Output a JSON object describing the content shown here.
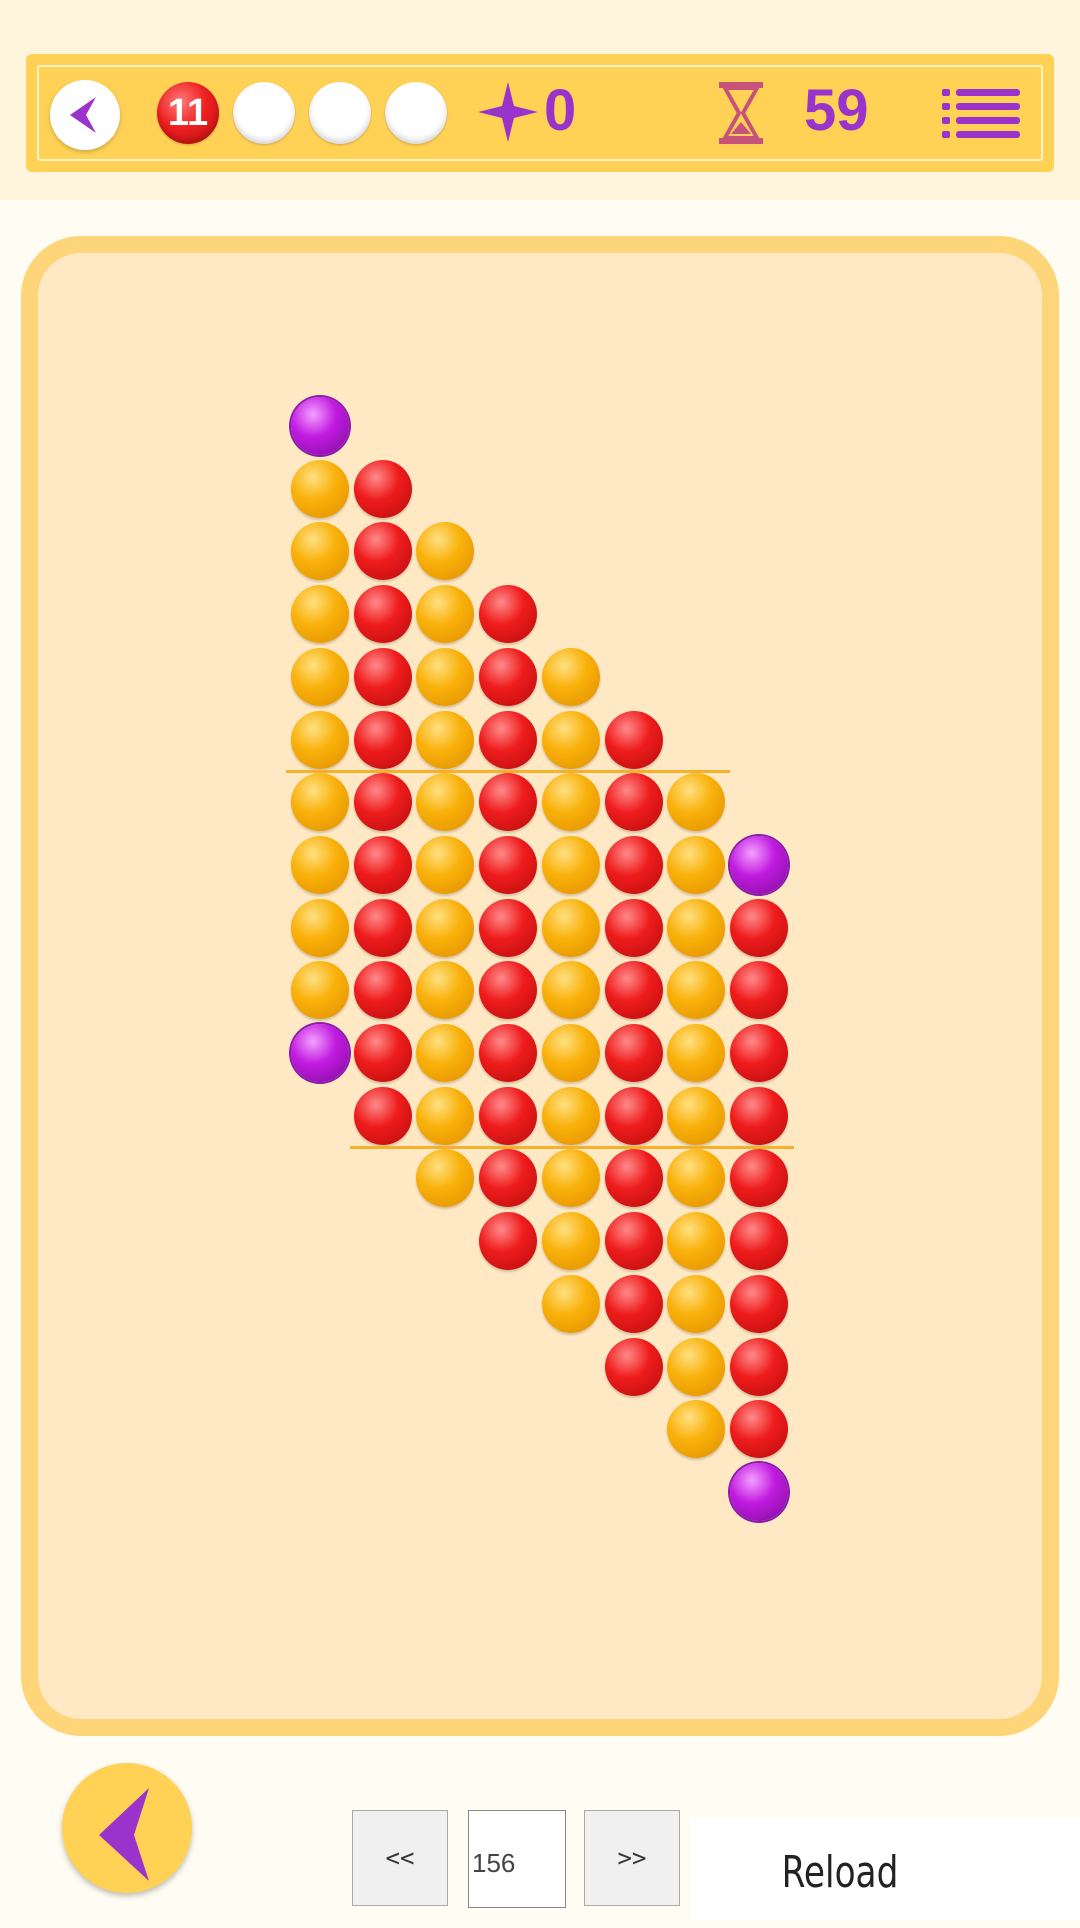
{
  "hud": {
    "slots": [
      {
        "color": "red",
        "label": "11"
      },
      {
        "color": "empty",
        "label": ""
      },
      {
        "color": "empty",
        "label": ""
      },
      {
        "color": "empty",
        "label": ""
      }
    ],
    "score": "0",
    "timer": "59",
    "accent_color": "#9a33cc",
    "icons": [
      "back-arrow-icon",
      "star-icon",
      "hourglass-icon",
      "menu-list-icon"
    ]
  },
  "board": {
    "colors": {
      "orange": "#f9b10a",
      "red": "#ef1c1c",
      "purple": "#c11be0"
    },
    "rows": [
      "P.......",
      "OR......",
      "ORO.....",
      "OROR....",
      "ORORO...",
      "OROROR..",
      "ORORORO.",
      "ORORORO P",
      "ORORORORX",
      "ORORORORX",
      "PRORORORX",
      ".RORORORX",
      "..ORORORX",
      "...RORORX",
      "....ORORX",
      ".....RORX",
      "......ORX",
      ".......PX"
    ],
    "divider_after_rows": [
      5,
      11
    ]
  },
  "footer": {
    "prev_label": "<<",
    "next_label": ">>",
    "level_value": "156",
    "reload_label": "Reload"
  }
}
